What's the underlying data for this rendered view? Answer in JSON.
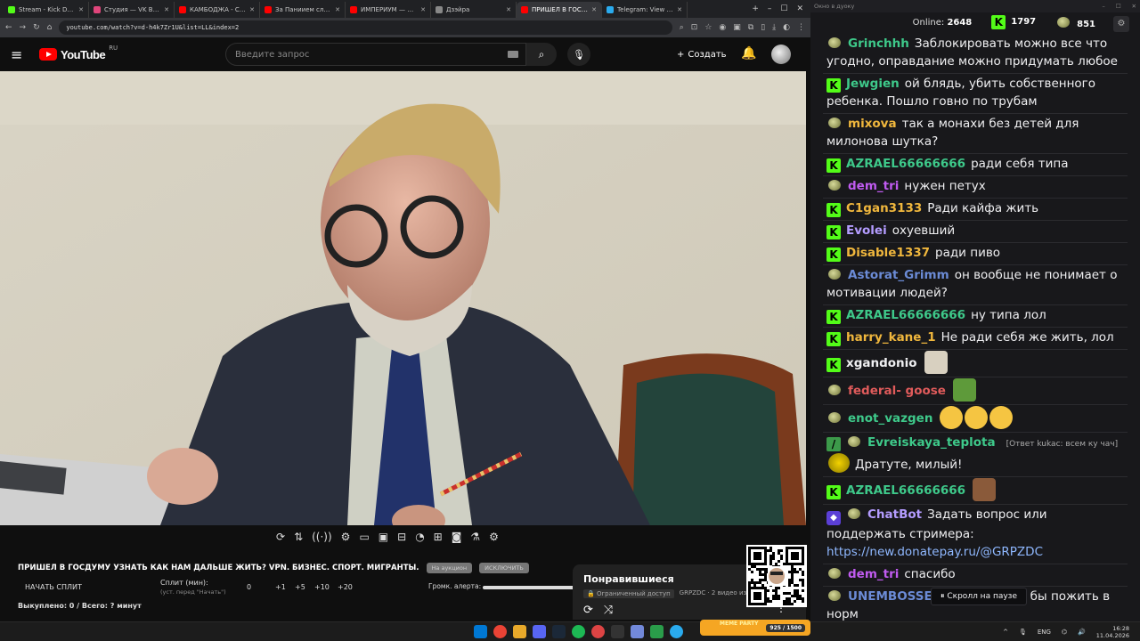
{
  "browser": {
    "tabs": [
      {
        "title": "Stream - Kick Dashboard",
        "color": "#53fc18"
      },
      {
        "title": "Студия — VK Видео Live",
        "color": "#e0457b"
      },
      {
        "title": "КАМБОДЖА - Столица",
        "color": "#ff0000"
      },
      {
        "title": "За Паниием следят в р",
        "color": "#ff0000"
      },
      {
        "title": "ИМПЕРИУМ — НЕ РО",
        "color": "#ff0000"
      },
      {
        "title": "Дзэйра",
        "color": "#888888"
      },
      {
        "title": "ПРИШЕЛ В ГОСДУМУ",
        "color": "#ff0000",
        "active": true
      },
      {
        "title": "Telegram: View @dvo",
        "color": "#2aabee"
      }
    ],
    "url": "youtube.com/watch?v=d-h4k7Zr1U&list=LL&index=2"
  },
  "youtube": {
    "logo": "YouTube",
    "region": "RU",
    "search_placeholder": "Введите запрос",
    "create_label": "Создать"
  },
  "player": {
    "stream_title": "ПРИШЕЛ В ГОСДУМУ УЗНАТЬ КАК НАМ ДАЛЬШЕ ЖИТЬ? VPN. БИЗНЕС. СПОРТ. МИГРАНТЫ.",
    "pill1": "На аукцион",
    "pill2": "ИСКЛЮЧИТЬ",
    "start_split": "НАЧАТЬ СПЛИТ",
    "split_label": "Сплит (мин):",
    "split_hint": "(уст. перед \"Начать\")",
    "split_values": [
      "0",
      "+1",
      "+5",
      "+10",
      "+20"
    ],
    "alert_label": "Громк. алерта:",
    "bought": "Выкуплено: 0 / Всего: ? минут"
  },
  "liked": {
    "title": "Понравившиеся",
    "restricted": "Ограниченный доступ",
    "channel": "GRPZDC · 2 видео из 1 2"
  },
  "chat": {
    "window_title": "Окно в дуоку",
    "online_label": "Online:",
    "online_count": "2648",
    "kick_count": "1797",
    "other_count": "851",
    "messages": [
      {
        "badge": "f",
        "user": "Grinchhh",
        "color": "#3ec98a",
        "text": "Заблокировать можно все что угодно, оправдание можно придумать любое"
      },
      {
        "badge": "k",
        "user": "Jewgien",
        "color": "#3ec98a",
        "text": "ой блядь, убить собственного ребенка. Пошло говно по трубам"
      },
      {
        "badge": "f",
        "user": "mixova",
        "color": "#f0b73d",
        "text": "так а монахи без детей для милонова шутка?"
      },
      {
        "badge": "k",
        "user": "AZRAEL66666666",
        "color": "#3ec98a",
        "text": "ради себя типа"
      },
      {
        "badge": "f",
        "user": "dem_tri",
        "color": "#c05bf0",
        "text": "нужен петух"
      },
      {
        "badge": "k",
        "user": "C1gan3133",
        "color": "#f0b73d",
        "text": "Ради кайфа жить"
      },
      {
        "badge": "k",
        "user": "Evolei",
        "color": "#b49cff",
        "text": "охуевший"
      },
      {
        "badge": "k",
        "user": "Disable1337",
        "color": "#f0b73d",
        "text": "ради пиво"
      },
      {
        "badge": "f",
        "user": "Astorat_Grimm",
        "color": "#6b8bd6",
        "text": "он вообще не понимает о мотивации людей?"
      },
      {
        "badge": "k",
        "user": "AZRAEL66666666",
        "color": "#3ec98a",
        "text": "ну типа лол"
      },
      {
        "badge": "k",
        "user": "harry_kane_1",
        "color": "#f0b73d",
        "text": "Не ради себя же жить, лол"
      },
      {
        "badge": "k",
        "user": "xgandonio",
        "color": "#efeff1",
        "text": "",
        "emote": "#d8d0c0"
      },
      {
        "badge": "f",
        "user": "federal- goose",
        "color": "#e05b5b",
        "text": "",
        "emote": "#5e9a3a"
      },
      {
        "badge": "f",
        "user": "enot_vazgen",
        "color": "#3ec98a",
        "text": "",
        "emote": "#f5c542",
        "emotes": 3
      },
      {
        "badge": "f2",
        "user": "Evreiskaya_teplota",
        "color": "#3ec98a",
        "reply": "[Ответ kukac: всем ку чач]",
        "text": "Дратуте, милый!"
      },
      {
        "badge": "k",
        "user": "AZRAEL66666666",
        "color": "#3ec98a",
        "text": "",
        "emote": "#8a5a3a"
      },
      {
        "badge": "b",
        "user": "ChatBot",
        "color": "#b49cff",
        "text": "Задать вопрос или поддержать стримера:",
        "link": "https://new.donatepay.ru/@GRPZDC"
      },
      {
        "badge": "f",
        "user": "dem_tri",
        "color": "#c05bf0",
        "text": "спасибо"
      },
      {
        "badge": "f",
        "user": "UNEMBOSSED",
        "color": "#6b8bd6",
        "text": "хз, хотелось бы пожить в норм"
      }
    ],
    "paused": "Скролл на паузе"
  },
  "taskbar": {
    "meme": "MEME PARTY",
    "meme_count": "925 / 1500",
    "lang": "ENG",
    "time": "16:28",
    "date": "11.04.2026"
  }
}
